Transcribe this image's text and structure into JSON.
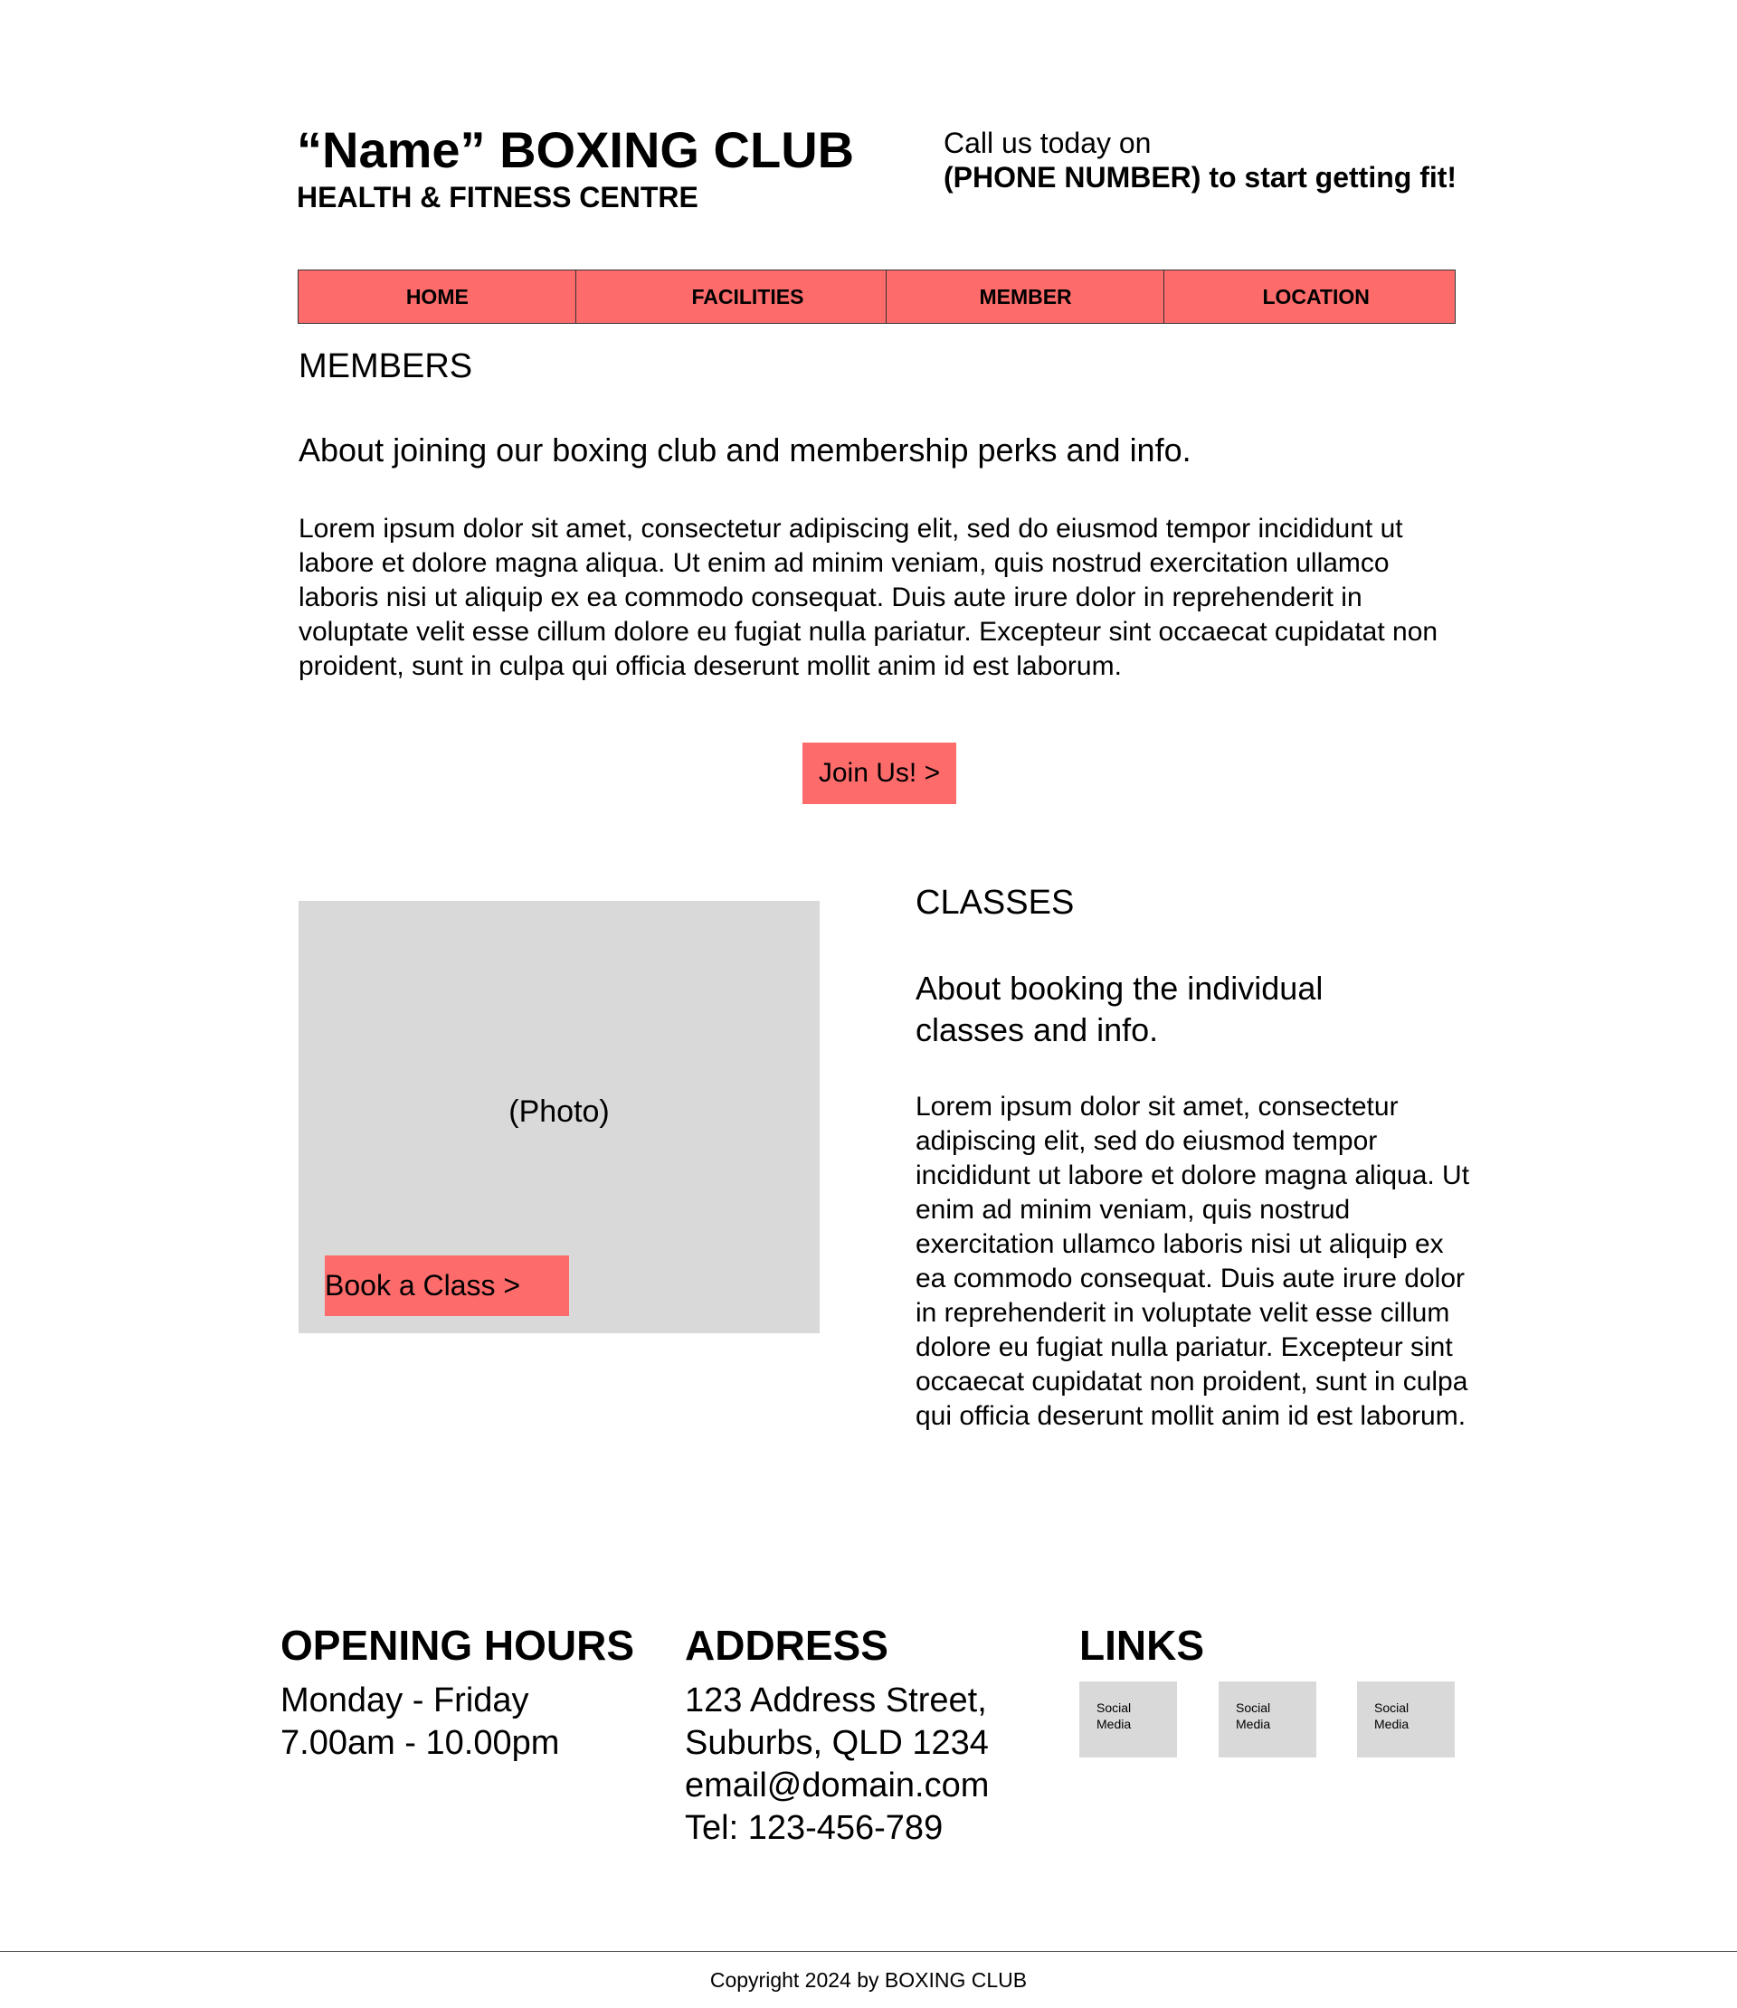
{
  "header": {
    "title": "“Name” BOXING CLUB",
    "subtitle": "HEALTH & FITNESS CENTRE",
    "call_line_1": "Call us today on",
    "call_line_2": "(PHONE NUMBER) to start getting fit!"
  },
  "nav": {
    "items": [
      {
        "label": "HOME"
      },
      {
        "label": "FACILITIES"
      },
      {
        "label": "MEMBER"
      },
      {
        "label": "LOCATION"
      }
    ]
  },
  "members": {
    "heading": "MEMBERS",
    "subheading": "About joining our boxing club and membership perks and info.",
    "body": "Lorem ipsum dolor sit amet, consectetur adipiscing elit, sed do eiusmod tempor incididunt ut labore et dolore magna aliqua. Ut enim ad minim veniam, quis nostrud exercitation ullamco laboris nisi ut aliquip ex ea commodo consequat. Duis aute irure dolor in reprehenderit in voluptate velit esse cillum dolore eu fugiat nulla pariatur. Excepteur sint occaecat cupidatat non proident, sunt in culpa qui officia deserunt mollit anim id est laborum.",
    "join_button": "Join Us! >"
  },
  "classes": {
    "photo_label": "(Photo)",
    "book_button": "Book a Class >",
    "heading": "CLASSES",
    "subheading": "About booking the individual classes and info.",
    "body": "Lorem ipsum dolor sit amet, consectetur adipiscing elit, sed do eiusmod tempor incididunt ut labore et dolore magna aliqua. Ut enim ad minim veniam, quis nostrud exercitation ullamco laboris nisi ut aliquip ex ea commodo consequat. Duis aute irure dolor in reprehenderit in voluptate velit esse cillum dolore eu fugiat nulla pariatur. Excepteur sint occaecat cupidatat non proident, sunt in culpa qui officia deserunt mollit anim id est laborum."
  },
  "opening_hours": {
    "title": "OPENING HOURS",
    "days": "Monday - Friday",
    "hours": "7.00am - 10.00pm"
  },
  "address": {
    "title": "ADDRESS",
    "street": "123 Address Street,",
    "suburb": "Suburbs, QLD 1234",
    "email": "email@domain.com",
    "tel": "Tel: 123-456-789"
  },
  "links": {
    "title": "LINKS",
    "social": [
      {
        "line1": "Social",
        "line2": "Media"
      },
      {
        "line1": "Social",
        "line2": "Media"
      },
      {
        "line1": "Social",
        "line2": "Media"
      }
    ]
  },
  "footer": {
    "copyright": "Copyright 2024 by BOXING CLUB"
  },
  "colors": {
    "accent": "#fd6b6b",
    "placeholder_gray": "#d9d9d9"
  }
}
